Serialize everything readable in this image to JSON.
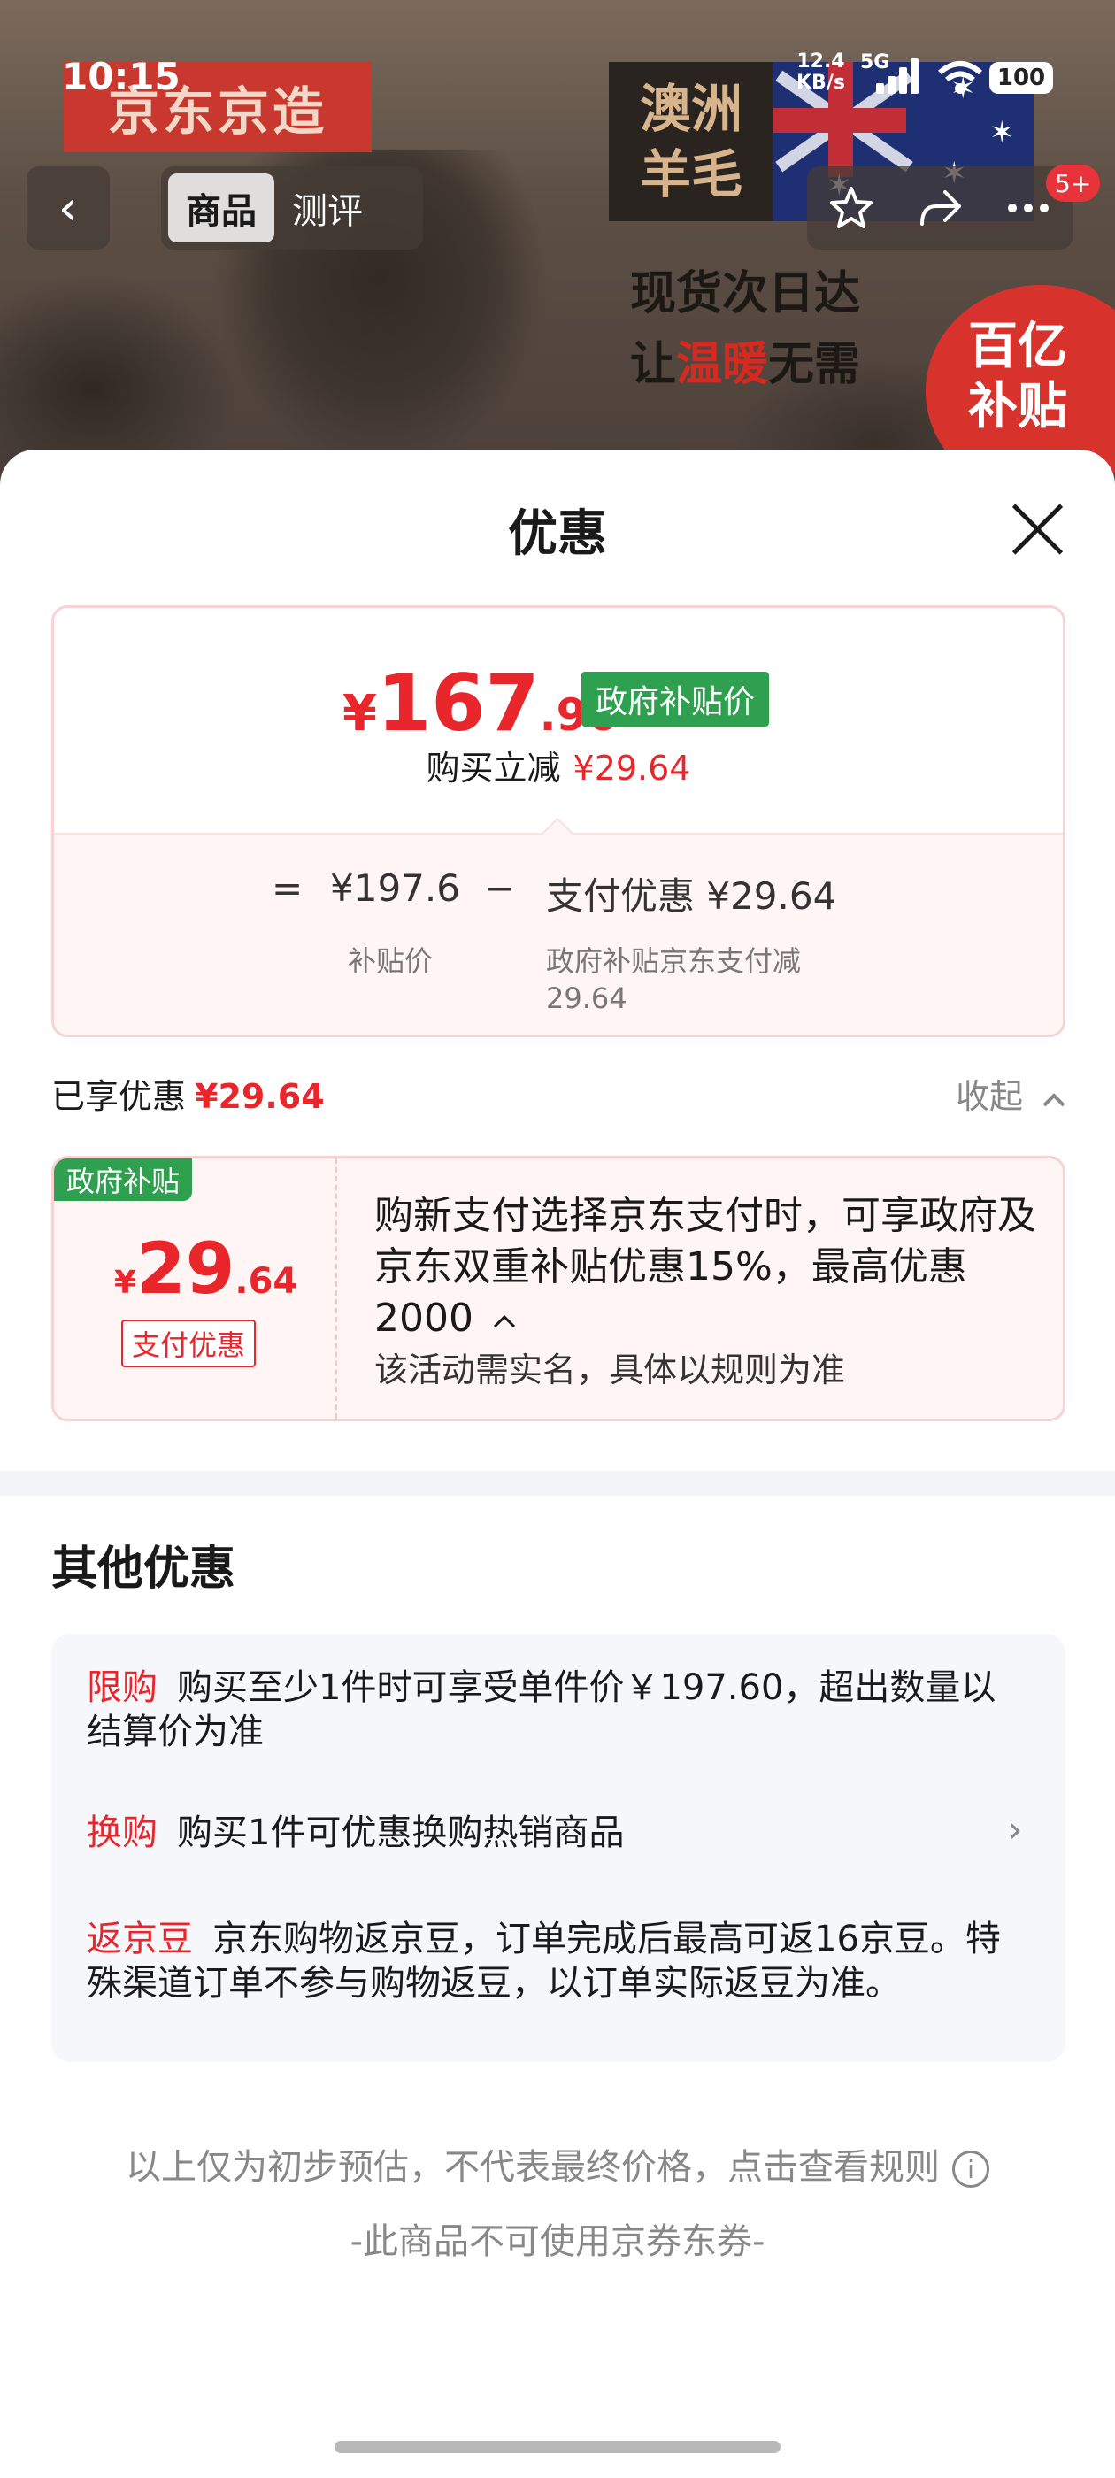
{
  "status_bar": {
    "time": "10:15",
    "net_speed_value": "12.4",
    "net_speed_unit": "KB/s",
    "network_type": "5G",
    "battery": "100"
  },
  "background": {
    "brand": "京东京造",
    "wool_line1": "澳洲",
    "wool_line2": "羊毛",
    "promo_line1": "现货次日达",
    "promo_line2_pre": "让",
    "promo_line2_warm": "温暖",
    "promo_line2_post": "无需",
    "badge_line1": "百亿",
    "badge_line2": "补贴"
  },
  "nav": {
    "tabs": [
      "商品",
      "测评"
    ],
    "notification_count": "5+"
  },
  "sheet": {
    "title": "优惠",
    "price": {
      "yen": "¥",
      "integer": "167",
      "decimal": ".96",
      "tag": "政府补贴价",
      "instant_cut_label": "购买立减",
      "instant_cut_value": "¥29.64"
    },
    "calc": {
      "equals": "=",
      "base_price": "¥197.6",
      "minus": "−",
      "discount_text": "支付优惠 ¥29.64",
      "base_label": "补贴价",
      "discount_label_line1": "政府补贴京东支付减",
      "discount_label_line2": "29.64"
    },
    "enjoyed": {
      "label": "已享优惠",
      "value": "¥29.64",
      "collapse_label": "收起"
    },
    "coupon": {
      "tag": "政府补贴",
      "yen": "¥",
      "integer": "29",
      "decimal": ".64",
      "type": "支付优惠",
      "description": "购新支付选择京东支付时，可享政府及京东双重补贴优惠15%，最高优惠2000",
      "note": "该活动需实名，具体以规则为准"
    },
    "other": {
      "title": "其他优惠",
      "items": [
        {
          "tag": "限购",
          "text": "购买至少1件时可享受单件价￥197.60，超出数量以结算价为准"
        },
        {
          "tag": "换购",
          "text": "购买1件可优惠换购热销商品"
        },
        {
          "tag": "返京豆",
          "text": "京东购物返京豆，订单完成后最高可返16京豆。特殊渠道订单不参与购物返豆，以订单实际返豆为准。"
        }
      ]
    },
    "disclaimer": "以上仅为初步预估，不代表最终价格，点击查看规则",
    "no_coupon": "-此商品不可使用京券东券-"
  },
  "colors": {
    "accent_red": "#e8262b",
    "subsidy_green": "#2ea04f",
    "muted_gray": "#888888"
  },
  "icons": {
    "back": "chevron-left-icon",
    "star": "star-icon",
    "share": "share-icon",
    "more": "more-icon",
    "close": "close-icon",
    "collapse": "chevron-up-icon",
    "expand": "chevron-up-icon",
    "item_arrow": "chevron-right-icon",
    "info": "info-icon"
  }
}
